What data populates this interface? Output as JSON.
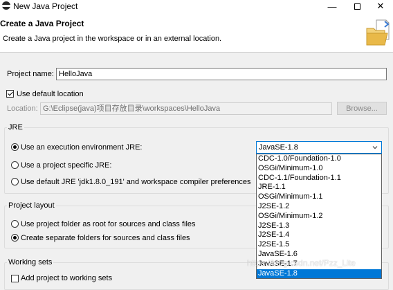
{
  "window": {
    "title": "New Java Project",
    "minimize": "—",
    "close": "✕"
  },
  "header": {
    "title": "Create a Java Project",
    "description": "Create a Java project in the workspace or in an external location."
  },
  "project_name": {
    "label": "Project name:",
    "value": "HelloJava"
  },
  "location": {
    "use_default_label": "Use default location",
    "use_default_checked": true,
    "label": "Location:",
    "value": "G:\\Eclipse(java)项目存放目录\\workspaces\\HelloJava",
    "browse_label": "Browse..."
  },
  "jre": {
    "group_label": "JRE",
    "option_execution_env": "Use an execution environment JRE:",
    "option_project_specific": "Use a project specific JRE:",
    "option_default": "Use default JRE 'jdk1.8.0_191' and workspace compiler preferences",
    "selected_env": "JavaSE-1.8",
    "env_options": [
      "CDC-1.0/Foundation-1.0",
      "OSGi/Minimum-1.0",
      "CDC-1.1/Foundation-1.1",
      "JRE-1.1",
      "OSGi/Minimum-1.1",
      "J2SE-1.2",
      "OSGi/Minimum-1.2",
      "J2SE-1.3",
      "J2SE-1.4",
      "J2SE-1.5",
      "JavaSE-1.6",
      "JavaSE-1.7",
      "JavaSE-1.8"
    ]
  },
  "project_layout": {
    "group_label": "Project layout",
    "option_root": "Use project folder as root for sources and class files",
    "option_separate": "Create separate folders for sources and class files"
  },
  "working_sets": {
    "group_label": "Working sets",
    "add_label": "Add project to working sets"
  },
  "watermark": "https://blog.csdn.net/Pzz_Lite",
  "colors": {
    "selection": "#0078d7",
    "background": "#f0f0f0"
  }
}
